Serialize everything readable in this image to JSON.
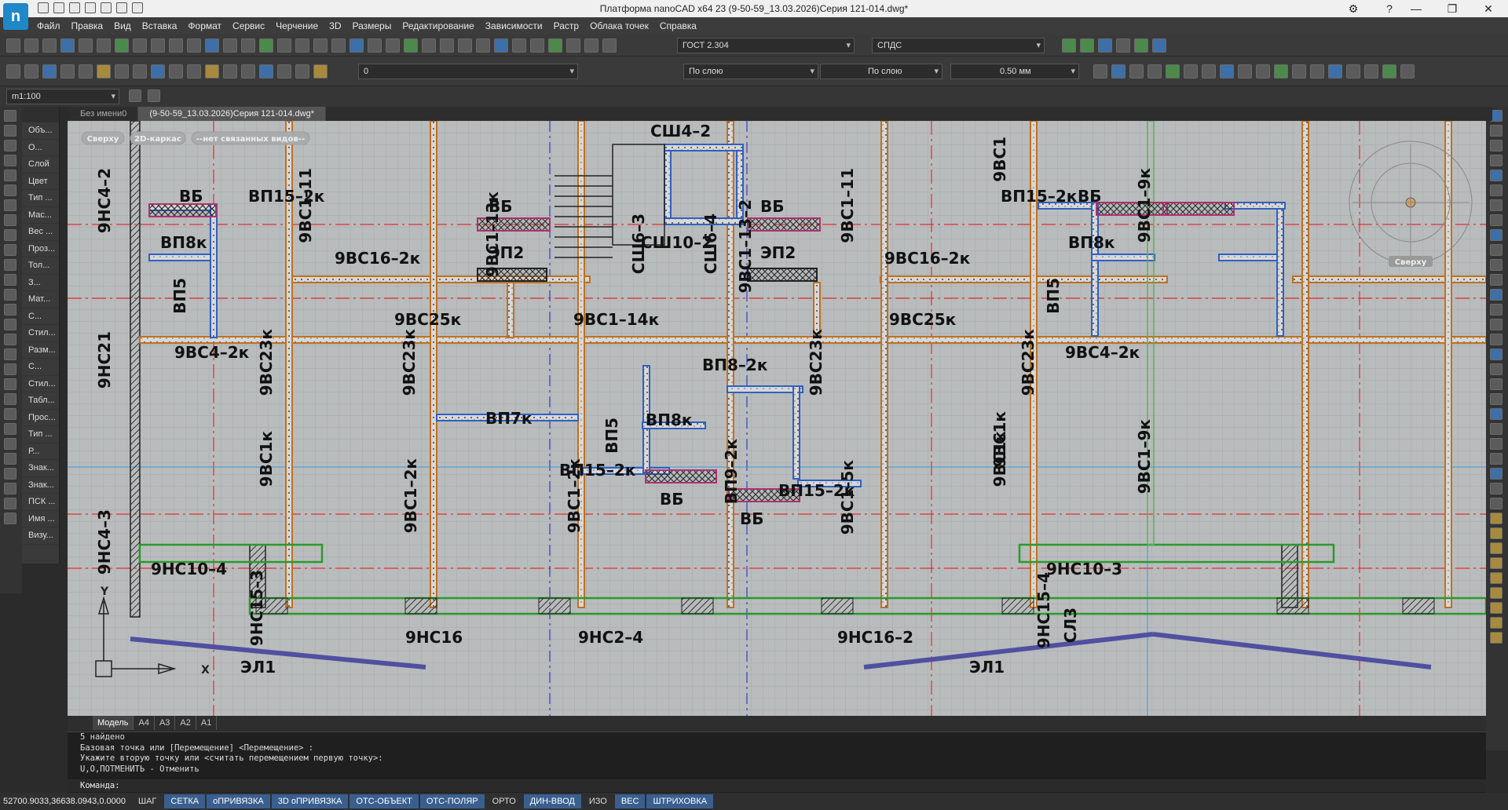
{
  "app": {
    "logo_letter": "n",
    "title": "Платформа nanoCAD x64 23 (9-50-59_13.03.2026)Серия 121-014.dwg*",
    "help": "?"
  },
  "menu": [
    "Файл",
    "Правка",
    "Вид",
    "Вставка",
    "Формат",
    "Сервис",
    "Черчение",
    "3D",
    "Размеры",
    "Редактирование",
    "Зависимости",
    "Растр",
    "Облака точек",
    "Справка"
  ],
  "toolbar": {
    "text_style": "ГОСТ 2.304",
    "dim_style": "СПДС",
    "layer": "0",
    "color": "По слою",
    "linetype": "По слою",
    "lineweight": "0.50 мм"
  },
  "scale": "m1:100",
  "doc_tabs": [
    {
      "label": "Без имени0",
      "active": false
    },
    {
      "label": "(9-50-59_13.03.2026)Серия 121-014.dwg*",
      "active": true
    }
  ],
  "canvas_chips": [
    "Сверху",
    "2D-каркас",
    "--нет связанных видов--"
  ],
  "left_panel": [
    "Объ...",
    "О...",
    "Слой",
    "Цвет",
    "Тип ...",
    "Мас...",
    "Вес ...",
    "Проз...",
    "Тол...",
    "З...",
    "Мат...",
    "С...",
    "Стил...",
    "Разм...",
    "С...",
    "Стил...",
    "Табл...",
    "Прос...",
    "Тип ...",
    "Р...",
    "Знак...",
    "Знак...",
    "ПСК ...",
    "Имя ...",
    "Визу..."
  ],
  "model_tabs": [
    {
      "label": "Модель",
      "active": true
    },
    {
      "label": "A4",
      "active": false
    },
    {
      "label": "A3",
      "active": false
    },
    {
      "label": "A2",
      "active": false
    },
    {
      "label": "A1",
      "active": false
    }
  ],
  "viewcube_label": "Сверху",
  "command": {
    "lines": [
      "5 найдено",
      "Базовая точка или [Перемещение] <Перемещение> :",
      "Укажите вторую точку или <считать перемещением первую точку>:",
      "U,O,ПОТМЕНИТЬ - Отменить"
    ],
    "prompt": "Команда:",
    "side_label": "Команд"
  },
  "status": {
    "coords": "52700.9033,36638.0943,0.0000",
    "toggles": [
      {
        "label": "ШАГ",
        "on": false
      },
      {
        "label": "СЕТКА",
        "on": true
      },
      {
        "label": "оПРИВЯЗКА",
        "on": true
      },
      {
        "label": "3D оПРИВЯЗКА",
        "on": true
      },
      {
        "label": "ОТС-ОБЪЕКТ",
        "on": true
      },
      {
        "label": "ОТС-ПОЛЯР",
        "on": true
      },
      {
        "label": "ОРТО",
        "on": false
      },
      {
        "label": "ДИН-ВВОД",
        "on": true
      },
      {
        "label": "ИЗО",
        "on": false
      },
      {
        "label": "ВЕС",
        "on": true
      },
      {
        "label": "ШТРИХОВКА",
        "on": true
      }
    ]
  },
  "drawing_labels": {
    "h": [
      "ВБ",
      "ВП15–2к",
      "ВП8к",
      "9ВС16–2к",
      "9ВС25к",
      "9ВС4–2к",
      "ВБ",
      "ЭП2",
      "СШ4–2",
      "СШ10–2",
      "ВБ",
      "ЭП2",
      "9ВС1–14к",
      "ВП7к",
      "ВП8к",
      "ВП8–2к",
      "ВП15–2к",
      "ВБ",
      "ВП15–2к",
      "ВБ",
      "9ВС16–2к",
      "9ВС25к",
      "ВП15–2к",
      "ВБ",
      "ВП8к",
      "9ВС4–2к",
      "9НС10–4",
      "9НС16",
      "9НС2–4",
      "9НС16–2",
      "9НС10–3",
      "ЭЛ1",
      "ЭЛ1"
    ],
    "v": [
      "9НС4–2",
      "9ВС1–11",
      "9ВС1–13к",
      "9ВС1–13–2",
      "9ВС1–11",
      "9ВС1",
      "9ВС1–9к",
      "ВП5",
      "9НС21",
      "9ВС23к",
      "9ВС23к",
      "9ВС23к",
      "9ВС23к",
      "ВП5",
      "СШ6–3",
      "СШ6–4",
      "9НС4–3",
      "9ВС1к",
      "9ВС1–2к",
      "9ВС1–2к",
      "ВП5",
      "ВП9–2к",
      "9ВС1–5к",
      "9ВС1к",
      "9ВС1–9к",
      "9ВС1к",
      "9НС15–3",
      "9НС15–4",
      "СЛ3"
    ]
  },
  "axis_labels": {
    "y": "Y",
    "x": "X"
  }
}
